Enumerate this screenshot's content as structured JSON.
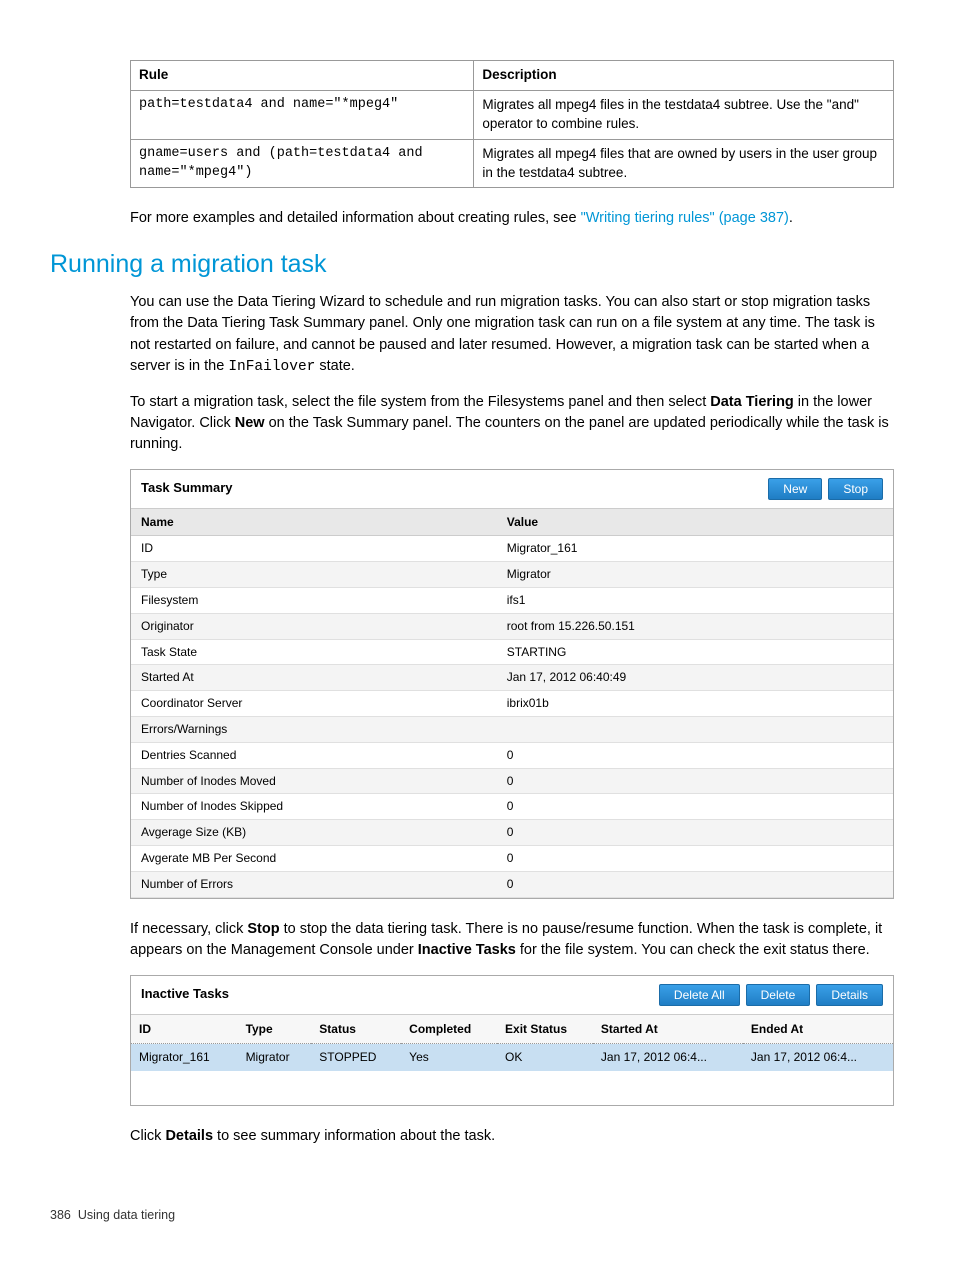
{
  "rules_table": {
    "headers": {
      "rule": "Rule",
      "description": "Description"
    },
    "rows": [
      {
        "rule": "path=testdata4 and name=\"*mpeg4\"",
        "description": "Migrates all mpeg4 files in the testdata4 subtree. Use the \"and\" operator to combine rules."
      },
      {
        "rule": "gname=users and (path=testdata4 and name=\"*mpeg4\")",
        "description": "Migrates all mpeg4 files that are owned by users in the user group in the testdata4 subtree."
      }
    ]
  },
  "para1_pre": "For more examples and detailed information about creating rules, see ",
  "para1_link": "\"Writing tiering rules\" (page 387)",
  "para1_post": ".",
  "heading": "Running a migration task",
  "para2_a": "You can use the Data Tiering Wizard to schedule and run migration tasks. You can also start or stop migration tasks from the Data Tiering Task Summary panel. Only one migration task can run on a file system at any time. The task is not restarted on failure, and cannot be paused and later resumed. However, a migration task can be started when a server is in the ",
  "para2_code": "InFailover",
  "para2_b": " state.",
  "para3_a": "To start a migration task, select the file system from the Filesystems panel and then select ",
  "para3_bold1": "Data Tiering",
  "para3_b": " in the lower Navigator. Click ",
  "para3_bold2": "New",
  "para3_c": " on the Task Summary panel. The counters on the panel are updated periodically while the task is running.",
  "task_summary": {
    "title": "Task Summary",
    "new_btn": "New",
    "stop_btn": "Stop",
    "col_name": "Name",
    "col_value": "Value",
    "rows": [
      {
        "name": "ID",
        "value": "Migrator_161"
      },
      {
        "name": "Type",
        "value": "Migrator"
      },
      {
        "name": "Filesystem",
        "value": "ifs1"
      },
      {
        "name": "Originator",
        "value": "root from 15.226.50.151"
      },
      {
        "name": "Task State",
        "value": "STARTING"
      },
      {
        "name": "Started At",
        "value": "Jan 17, 2012 06:40:49"
      },
      {
        "name": "Coordinator Server",
        "value": "ibrix01b"
      },
      {
        "name": "Errors/Warnings",
        "value": ""
      },
      {
        "name": "Dentries Scanned",
        "value": "0"
      },
      {
        "name": "Number of Inodes Moved",
        "value": "0"
      },
      {
        "name": "Number of Inodes Skipped",
        "value": "0"
      },
      {
        "name": "Avgerage Size (KB)",
        "value": "0"
      },
      {
        "name": "Avgerate MB Per Second",
        "value": "0"
      },
      {
        "name": "Number of Errors",
        "value": "0"
      }
    ]
  },
  "para4_a": "If necessary, click ",
  "para4_bold1": "Stop",
  "para4_b": " to stop the data tiering task. There is no pause/resume function. When the task is complete, it appears on the Management Console under ",
  "para4_bold2": "Inactive Tasks",
  "para4_c": " for the file system. You can check the exit status there.",
  "inactive_tasks": {
    "title": "Inactive Tasks",
    "delete_all_btn": "Delete All",
    "delete_btn": "Delete",
    "details_btn": "Details",
    "headers": {
      "id": "ID",
      "type": "Type",
      "status": "Status",
      "completed": "Completed",
      "exit_status": "Exit Status",
      "started_at": "Started At",
      "ended_at": "Ended At"
    },
    "row": {
      "id": "Migrator_161",
      "type": "Migrator",
      "status": "STOPPED",
      "completed": "Yes",
      "exit_status": "OK",
      "started_at": "Jan 17, 2012 06:4...",
      "ended_at": "Jan 17, 2012 06:4..."
    }
  },
  "para5_a": "Click ",
  "para5_bold": "Details",
  "para5_b": " to see summary information about the task.",
  "footer_page": "386",
  "footer_text": "Using data tiering"
}
